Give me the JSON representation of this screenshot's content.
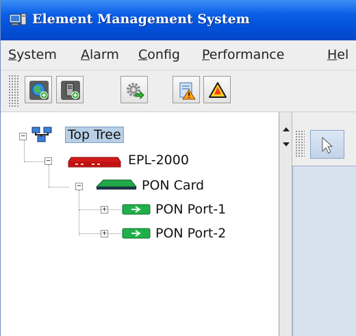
{
  "window": {
    "title": "Element Management System"
  },
  "menu": {
    "items": [
      {
        "mnemonic": "S",
        "rest": "ystem"
      },
      {
        "mnemonic": "A",
        "rest": "larm"
      },
      {
        "mnemonic": "C",
        "rest": "onfig"
      },
      {
        "mnemonic": "P",
        "rest": "erformance"
      },
      {
        "mnemonic": "H",
        "rest": "el"
      }
    ]
  },
  "toolbar": {
    "buttons": [
      "globe-add-icon",
      "server-add-icon",
      "gear-refresh-icon",
      "report-alarm-icon",
      "warning-icon"
    ]
  },
  "tree": {
    "nodes": [
      {
        "label": "Top Tree",
        "icon": "network-tree-icon",
        "expanded": true,
        "selected": true
      },
      {
        "label": "EPL-2000",
        "icon": "red-device-icon",
        "expanded": true
      },
      {
        "label": "PON Card",
        "icon": "green-card-icon",
        "expanded": true
      },
      {
        "label": "PON Port-1",
        "icon": "green-port-icon",
        "expanded": false
      },
      {
        "label": "PON Port-2",
        "icon": "green-port-icon",
        "expanded": false
      }
    ]
  },
  "colors": {
    "titlebar": "#0450d8",
    "selection": "#b8cfe5",
    "device_red": "#d01818",
    "card_green": "#1aa03a"
  }
}
